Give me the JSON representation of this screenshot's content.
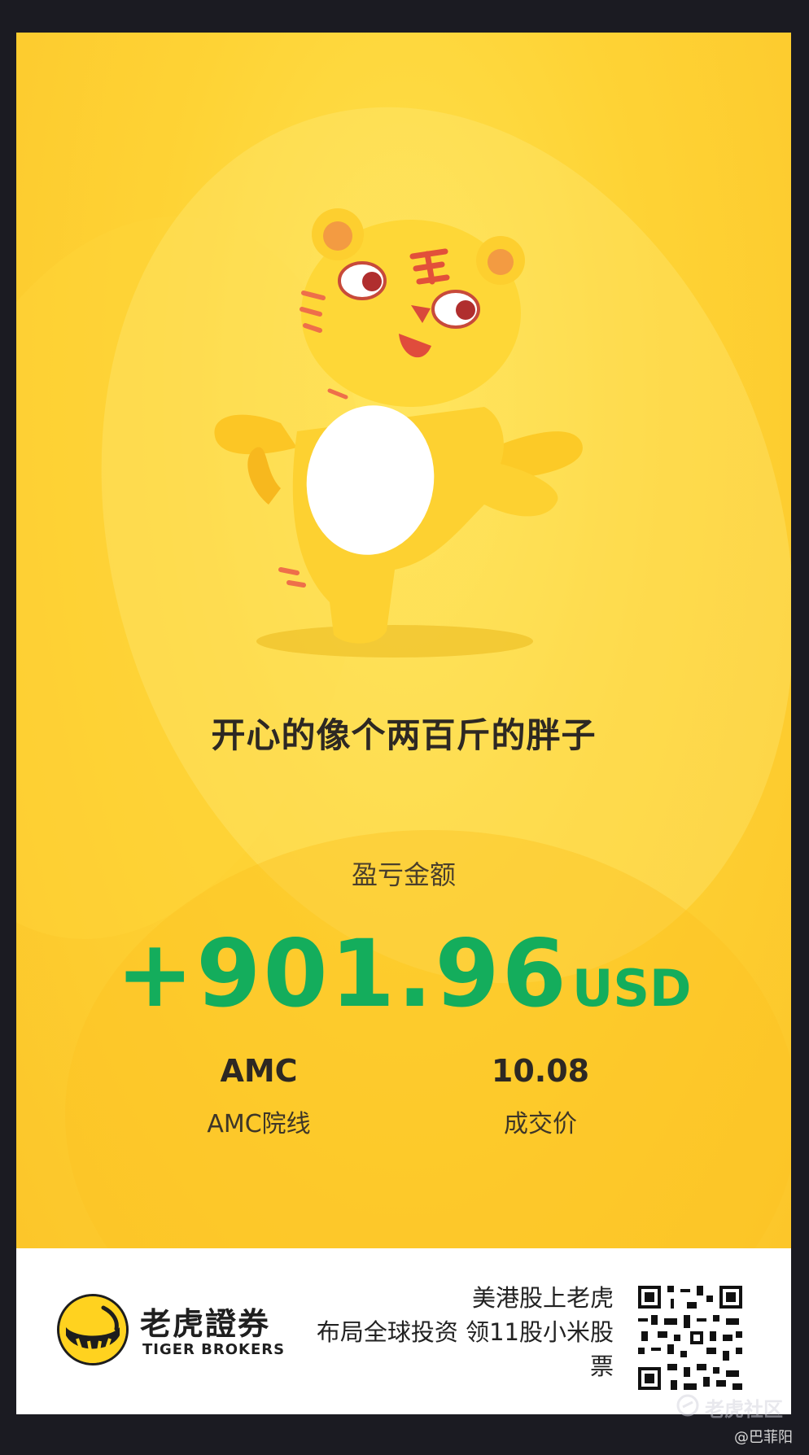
{
  "poster": {
    "headline": "开心的像个两百斤的胖子",
    "pl_label": "盈亏金额",
    "pl_amount": "+901.96",
    "pl_currency": "USD",
    "stock": {
      "symbol": "AMC",
      "name": "AMC院线"
    },
    "price": {
      "value": "10.08",
      "label": "成交价"
    },
    "colors": {
      "background": "#fed335",
      "profit_green": "#14ad5c"
    },
    "mascot_icon": "tiger-mascot"
  },
  "footer": {
    "brand_cn": "老虎證券",
    "brand_en": "TIGER BROKERS",
    "promo_lines": [
      "美港股上老虎",
      "布局全球投资 领11股小米股",
      "票"
    ],
    "qr_icon": "qr-code"
  },
  "overlay": {
    "watermark": "老虎社区",
    "user_tag": "@巴菲阳"
  }
}
